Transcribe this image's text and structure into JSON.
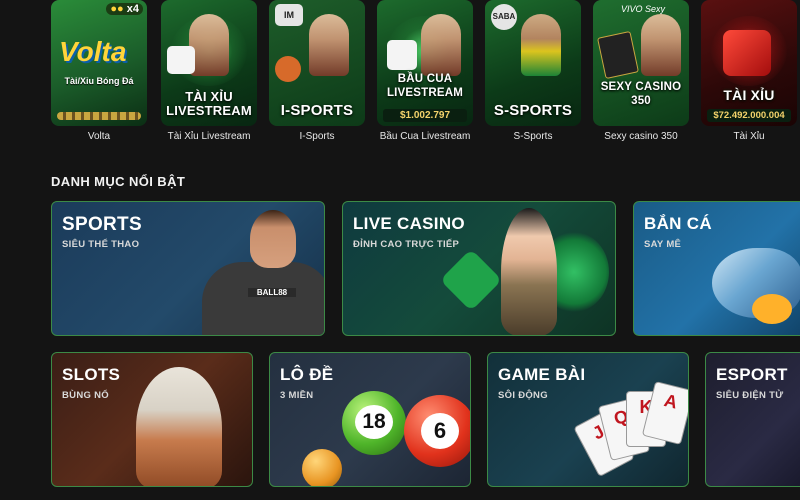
{
  "tiles": [
    {
      "label": "Volta",
      "art_title": "Volta",
      "art_subtitle": "Tài/Xỉu Bóng Đá",
      "coins": "x4"
    },
    {
      "label": "Tài Xỉu Livestream",
      "art_title": "TÀI XỈU LIVESTREAM"
    },
    {
      "label": "I-Sports",
      "art_title": "I-SPORTS",
      "badge": "IM"
    },
    {
      "label": "Bầu Cua Livestream",
      "art_title": "BẦU CUA LIVESTREAM",
      "amount": "$1.002.797"
    },
    {
      "label": "S-Sports",
      "art_title": "S-SPORTS",
      "badge": "SABA"
    },
    {
      "label": "Sexy casino 350",
      "art_title": "SEXY CASINO 350",
      "provider": "VIVO Sexy"
    },
    {
      "label": "Tài Xỉu",
      "art_title": "TÀI XỈU",
      "amount": "$72.492.000.004"
    }
  ],
  "section": {
    "title": "DANH MỤC NỔI BẬT"
  },
  "categories": [
    {
      "name": "SPORTS",
      "desc": "SIÊU THỂ THAO",
      "shirt": "BALL88"
    },
    {
      "name": "LIVE CASINO",
      "desc": "ĐỈNH CAO TRỰC TIẾP"
    },
    {
      "name": "BẮN CÁ",
      "desc": "SAY MÊ"
    },
    {
      "name": "SLOTS",
      "desc": "BÙNG NỔ"
    },
    {
      "name": "LÔ ĐỀ",
      "desc": "3 MIỀN",
      "balls": [
        "18",
        "6"
      ]
    },
    {
      "name": "GAME BÀI",
      "desc": "SÔI ĐỘNG",
      "cards": [
        "J",
        "Q",
        "K",
        "A"
      ]
    },
    {
      "name": "ESPORT",
      "desc": "SIÊU ĐIỆN TỬ"
    }
  ],
  "colors": {
    "background": "#141414",
    "card_border": "#3c8a46",
    "gold": "#ffd43a",
    "amount": "#f4d36b"
  }
}
